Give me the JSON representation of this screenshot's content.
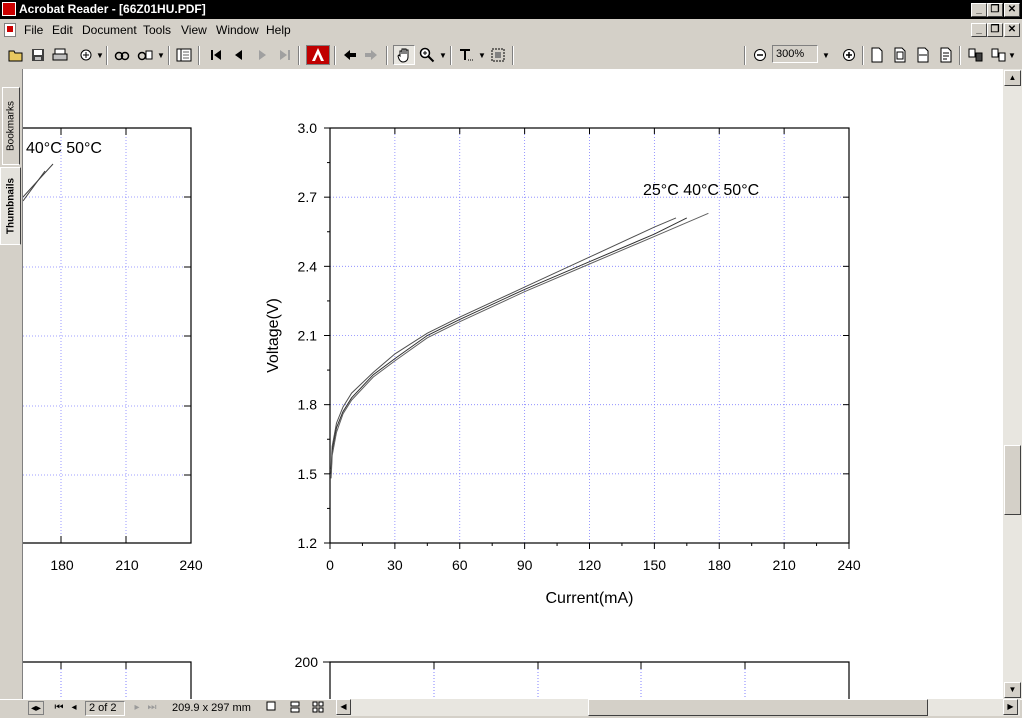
{
  "window": {
    "title": "Acrobat Reader - [66Z01HU.PDF]",
    "minimize": "_",
    "restore": "❐",
    "close": "✕"
  },
  "menu": [
    "File",
    "Edit",
    "Document",
    "Tools",
    "View",
    "Window",
    "Help"
  ],
  "toolbar": {
    "zoom_value": "300%",
    "icons": [
      "open-icon",
      "save-icon",
      "print-icon",
      "email-icon",
      "find-icon",
      "search-icon",
      "show-hide-navigation-icon",
      "first-page-icon",
      "previous-page-icon",
      "next-page-icon",
      "last-page-icon",
      "adobe-logo-icon",
      "go-back-icon",
      "go-forward-icon",
      "hand-tool-icon",
      "zoom-in-tool-icon",
      "text-select-tool-icon",
      "graphics-select-tool-icon",
      "zoom-out-icon",
      "zoom-in-icon",
      "actual-size-icon",
      "fit-page-icon",
      "fit-width-icon",
      "reflow-icon",
      "rotate-icon",
      "extract-icon"
    ]
  },
  "side_tabs": {
    "bookmarks": "Bookmarks",
    "thumbnails": "Thumbnails"
  },
  "status": {
    "page_indicator": "2 of 2",
    "page_size": "209.9 x 297 mm"
  },
  "left_chart_fragment": {
    "legend_text": "40°C 50°C",
    "x_ticks": [
      "180",
      "210",
      "240"
    ]
  },
  "bottom_chart_fragment": {
    "y_top_tick": "200"
  },
  "chart_data": {
    "type": "line",
    "xlabel": "Current(mA)",
    "ylabel": "Voltage(V)",
    "xlim": [
      0,
      240
    ],
    "ylim": [
      1.2,
      3.0
    ],
    "x_ticks": [
      0,
      30,
      60,
      90,
      120,
      150,
      180,
      210,
      240
    ],
    "y_ticks": [
      1.2,
      1.5,
      1.8,
      2.1,
      2.4,
      2.7,
      3.0
    ],
    "y_tick_labels": [
      "1.2",
      "1.5",
      "1.8",
      "2.1",
      "2.4",
      "2.7",
      "3.0"
    ],
    "grid": true,
    "legend_text": "25°C 40°C 50°C",
    "series": [
      {
        "name": "25°C",
        "x": [
          0.5,
          1,
          3,
          6,
          10,
          20,
          30,
          45,
          60,
          90,
          120,
          150,
          160
        ],
        "y": [
          1.52,
          1.62,
          1.72,
          1.79,
          1.85,
          1.94,
          2.02,
          2.11,
          2.18,
          2.31,
          2.44,
          2.57,
          2.61
        ]
      },
      {
        "name": "40°C",
        "x": [
          0.5,
          1,
          3,
          6,
          10,
          20,
          30,
          45,
          60,
          90,
          120,
          150,
          165
        ],
        "y": [
          1.5,
          1.6,
          1.7,
          1.77,
          1.83,
          1.93,
          2.0,
          2.1,
          2.17,
          2.3,
          2.42,
          2.54,
          2.61
        ]
      },
      {
        "name": "50°C",
        "x": [
          0.5,
          1,
          3,
          6,
          10,
          20,
          30,
          45,
          60,
          90,
          120,
          150,
          175
        ],
        "y": [
          1.48,
          1.58,
          1.68,
          1.76,
          1.82,
          1.92,
          1.99,
          2.09,
          2.16,
          2.29,
          2.41,
          2.53,
          2.63
        ]
      }
    ]
  }
}
